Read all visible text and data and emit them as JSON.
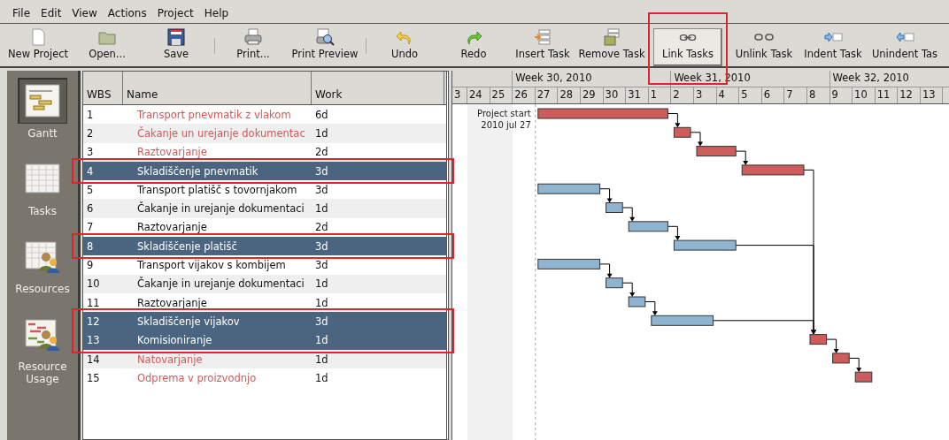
{
  "menu": [
    "File",
    "Edit",
    "View",
    "Actions",
    "Project",
    "Help"
  ],
  "toolbar": [
    {
      "kind": "button",
      "label": "New Project",
      "pressed": false,
      "framed": false
    },
    {
      "kind": "button",
      "label": "Open...",
      "pressed": false,
      "framed": false
    },
    {
      "kind": "button",
      "label": "Save",
      "pressed": false,
      "framed": false
    },
    {
      "kind": "separator"
    },
    {
      "kind": "button",
      "label": "Print...",
      "pressed": false,
      "framed": false
    },
    {
      "kind": "button",
      "label": "Print Preview",
      "pressed": false,
      "framed": false
    },
    {
      "kind": "separator"
    },
    {
      "kind": "button",
      "label": "Undo",
      "pressed": false,
      "framed": false
    },
    {
      "kind": "button",
      "label": "Redo",
      "pressed": false,
      "framed": false
    },
    {
      "kind": "button",
      "label": "Insert Task",
      "pressed": false,
      "framed": false
    },
    {
      "kind": "button",
      "label": "Remove Task",
      "pressed": false,
      "framed": false
    },
    {
      "kind": "button",
      "label": "Link Tasks",
      "pressed": true,
      "framed": true
    },
    {
      "kind": "button",
      "label": "Unlink Task",
      "pressed": false,
      "framed": false
    },
    {
      "kind": "button",
      "label": "Indent Task",
      "pressed": false,
      "framed": false
    },
    {
      "kind": "button",
      "label": "Unindent Tas",
      "pressed": false,
      "framed": false
    }
  ],
  "sidebar": {
    "items": [
      {
        "label": "Gantt",
        "selected": true
      },
      {
        "label": "Tasks",
        "selected": false
      },
      {
        "label": "Resources",
        "selected": false
      },
      {
        "label": "Resource Usage",
        "selected": false
      }
    ]
  },
  "table": {
    "columns": [
      "WBS",
      "Name",
      "Work"
    ],
    "rows": [
      {
        "wbs": "1",
        "name": "Transport pnevmatik z vlakom",
        "work": "6d",
        "critical": true,
        "selected": false,
        "framed": false
      },
      {
        "wbs": "2",
        "name": "Čakanje un urejanje dokumentac",
        "work": "1d",
        "critical": true,
        "selected": false,
        "framed": false
      },
      {
        "wbs": "3",
        "name": "Raztovarjanje",
        "work": "2d",
        "critical": true,
        "selected": false,
        "framed": false
      },
      {
        "wbs": "4",
        "name": "Skladiščenje pnevmatik",
        "work": "3d",
        "critical": true,
        "selected": true,
        "framed": true
      },
      {
        "wbs": "5",
        "name": "Transport platišč s tovornjakom",
        "work": "3d",
        "critical": false,
        "selected": false,
        "framed": false
      },
      {
        "wbs": "6",
        "name": "Čakanje in urejanje dokumentaci",
        "work": "1d",
        "critical": false,
        "selected": false,
        "framed": false
      },
      {
        "wbs": "7",
        "name": "Raztovarjanje",
        "work": "2d",
        "critical": false,
        "selected": false,
        "framed": false
      },
      {
        "wbs": "8",
        "name": "Skladiščenje platišč",
        "work": "3d",
        "critical": false,
        "selected": true,
        "framed": true
      },
      {
        "wbs": "9",
        "name": "Transport vijakov s kombijem",
        "work": "3d",
        "critical": false,
        "selected": false,
        "framed": false
      },
      {
        "wbs": "10",
        "name": "Čakanje in urejanje dokumentaci",
        "work": "1d",
        "critical": false,
        "selected": false,
        "framed": false
      },
      {
        "wbs": "11",
        "name": "Raztovarjanje",
        "work": "1d",
        "critical": false,
        "selected": false,
        "framed": false
      },
      {
        "wbs": "12",
        "name": "Skladiščenje vijakov",
        "work": "3d",
        "critical": false,
        "selected": true,
        "framed": true
      },
      {
        "wbs": "13",
        "name": "Komisioniranje",
        "work": "1d",
        "critical": true,
        "selected": true,
        "framed": true
      },
      {
        "wbs": "14",
        "name": "Natovarjanje",
        "work": "1d",
        "critical": true,
        "selected": false,
        "framed": false
      },
      {
        "wbs": "15",
        "name": "Odprema v proizvodnjo",
        "work": "1d",
        "critical": true,
        "selected": false,
        "framed": false
      }
    ]
  },
  "gantt": {
    "weeks": [
      "Week 30, 2010",
      "Week 31, 2010",
      "Week 32, 2010"
    ],
    "days": [
      {
        "label": "3",
        "shaded": false
      },
      {
        "label": "24",
        "shaded": true
      },
      {
        "label": "25",
        "shaded": true
      },
      {
        "label": "26",
        "shaded": false
      },
      {
        "label": "27",
        "shaded": false
      },
      {
        "label": "28",
        "shaded": false
      },
      {
        "label": "29",
        "shaded": false
      },
      {
        "label": "30",
        "shaded": false
      },
      {
        "label": "31",
        "shaded": false
      },
      {
        "label": "1",
        "shaded": false
      },
      {
        "label": "2",
        "shaded": false
      },
      {
        "label": "3",
        "shaded": false
      },
      {
        "label": "4",
        "shaded": false
      },
      {
        "label": "5",
        "shaded": false
      },
      {
        "label": "6",
        "shaded": false
      },
      {
        "label": "7",
        "shaded": false
      },
      {
        "label": "8",
        "shaded": false
      },
      {
        "label": "9",
        "shaded": false
      },
      {
        "label": "10",
        "shaded": false
      },
      {
        "label": "11",
        "shaded": false
      },
      {
        "label": "12",
        "shaded": false
      },
      {
        "label": "13",
        "shaded": false
      }
    ],
    "project_start": {
      "label": "Project start",
      "date": "2010 jul 27"
    }
  }
}
